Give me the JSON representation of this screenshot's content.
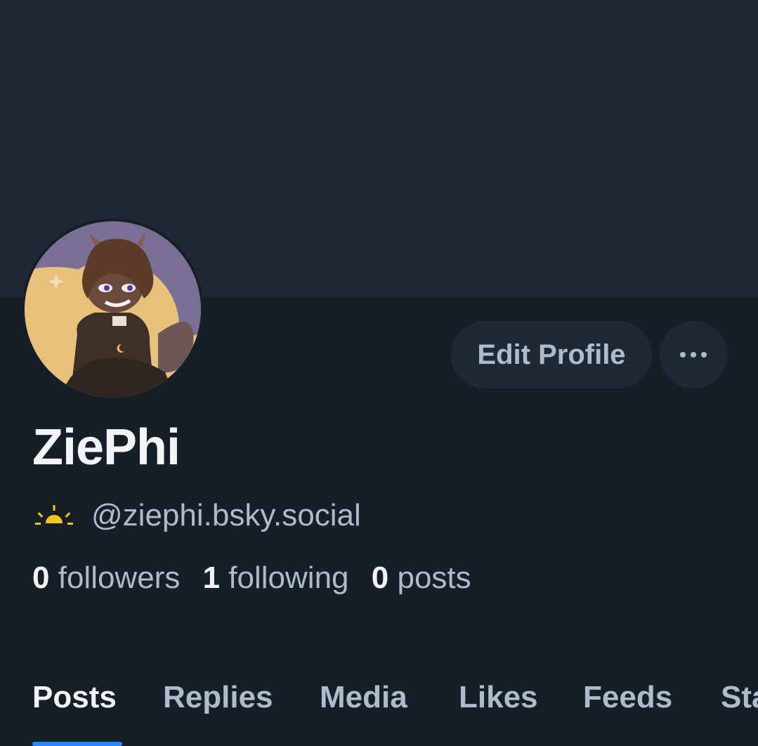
{
  "profile": {
    "display_name": "ZiePhi",
    "handle": "@ziephi.bsky.social",
    "handle_icon": "sunrise-icon",
    "avatar_alt": "illustrated character avatar"
  },
  "actions": {
    "edit_profile_label": "Edit Profile",
    "more_icon": "ellipsis-icon"
  },
  "stats": {
    "followers": {
      "count": "0",
      "label": "followers"
    },
    "following": {
      "count": "1",
      "label": "following"
    },
    "posts": {
      "count": "0",
      "label": "posts"
    }
  },
  "tabs": [
    {
      "label": "Posts",
      "active": true
    },
    {
      "label": "Replies",
      "active": false
    },
    {
      "label": "Media",
      "active": false
    },
    {
      "label": "Likes",
      "active": false
    },
    {
      "label": "Feeds",
      "active": false
    },
    {
      "label": "Starter Packs",
      "active": false
    }
  ],
  "colors": {
    "background": "#161e27",
    "banner": "#1e2935",
    "text_primary": "#f1f3f5",
    "text_secondary": "#aebbcb",
    "accent": "#208bfe",
    "handle_icon": "#f5c518"
  }
}
